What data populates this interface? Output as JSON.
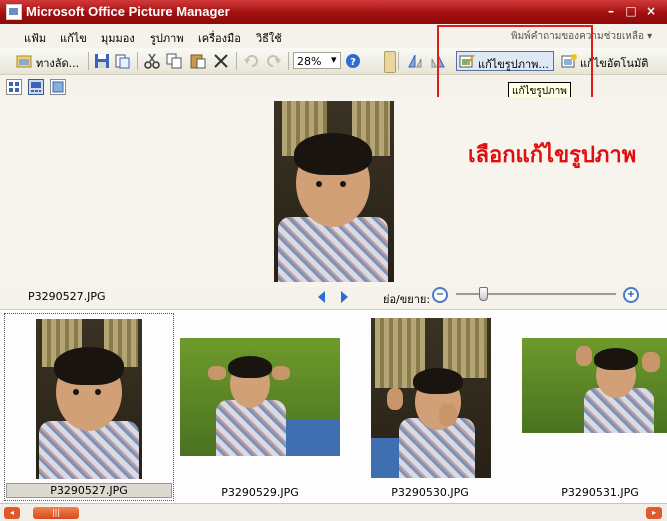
{
  "window": {
    "title": "Microsoft Office Picture Manager",
    "controls": {
      "minimize": "–",
      "maximize": "□",
      "close": "×"
    }
  },
  "menubar": {
    "items": [
      "แฟ้ม",
      "แก้ไข",
      "มุมมอง",
      "รูปภาพ",
      "เครื่องมือ",
      "วิธีใช้"
    ],
    "help_placeholder": "พิมพ์คำถามของความช่วยเหลือ",
    "help_dropdown": "▾"
  },
  "toolbar": {
    "shortcuts_label": "ทางลัด...",
    "zoom_value": "28%",
    "zoom_dropdown": "▾",
    "edit_pictures_label": "แก้ไขรูปภาพ...",
    "auto_correct_label": "แก้ไขอัตโนมัติ",
    "tooltip": "แก้ไขรูปภาพ",
    "icons": [
      "shortcut-icon",
      "save-icon",
      "export-icon",
      "cut-icon",
      "copy-icon",
      "paste-icon",
      "delete-icon",
      "undo-icon",
      "redo-icon",
      "help-icon",
      "rotate-left-icon",
      "rotate-right-icon",
      "edit-pictures-icon",
      "auto-correct-icon"
    ]
  },
  "annotation": "เลือกแก้ไขรูปภาพ",
  "preview": {
    "filename": "P3290527.JPG",
    "zoom_label": "ย่อ/ขยาย:",
    "zoom_out_symbol": "−",
    "zoom_in_symbol": "+",
    "zoom_slider_level": 0.17
  },
  "filmstrip": {
    "thumbnails": [
      {
        "filename": "P3290527.JPG",
        "selected": true
      },
      {
        "filename": "P3290529.JPG",
        "selected": false
      },
      {
        "filename": "P3290530.JPG",
        "selected": false
      },
      {
        "filename": "P3290531.JPG",
        "selected": false
      }
    ]
  },
  "scrollbar": {
    "left_arrow": "◂",
    "right_arrow": "▸",
    "thumb_grip": "|||"
  },
  "colors": {
    "title_bar": "#a10f0f",
    "annotation": "#e00e0e",
    "highlight_box": "#e01b1b",
    "nav_arrow": "#2d6ad3",
    "scroll": "#e05a2a"
  }
}
